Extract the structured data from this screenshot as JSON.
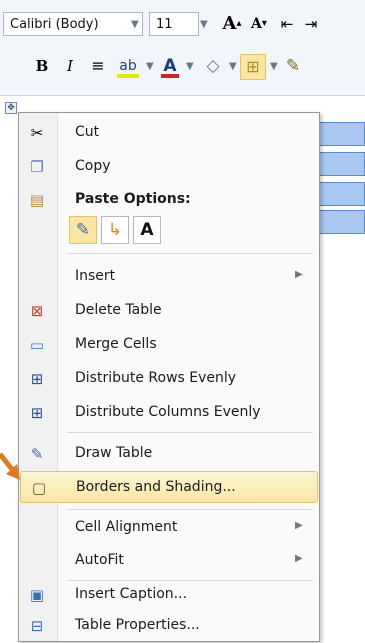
{
  "toolbar": {
    "font_name": "Calibri (Body)",
    "font_size": "11",
    "grow_font": "A",
    "shrink_font": "A",
    "bold": "B",
    "italic": "I"
  },
  "menu": {
    "cut": "Cut",
    "copy": "Copy",
    "paste_options": "Paste Options:",
    "paste_text_only": "A",
    "insert": "Insert",
    "delete_table": "Delete Table",
    "merge_cells": "Merge Cells",
    "distribute_rows": "Distribute Rows Evenly",
    "distribute_columns": "Distribute Columns Evenly",
    "draw_table": "Draw Table",
    "borders_shading": "Borders and Shading...",
    "cell_alignment": "Cell Alignment",
    "autofit": "AutoFit",
    "insert_caption": "Insert Caption...",
    "table_properties": "Table Properties..."
  },
  "colors": {
    "highlight": "#fbe7a2",
    "arrow": "#e07a1f",
    "table_fill": "#a9c9f3",
    "font_color": "#d42020"
  }
}
